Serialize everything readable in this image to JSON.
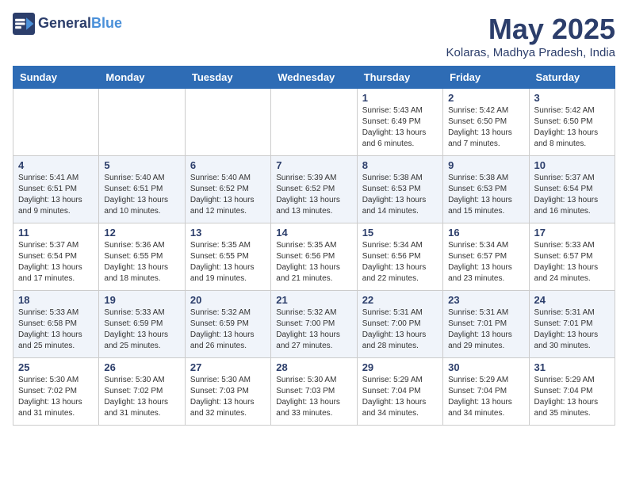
{
  "header": {
    "logo_line1": "General",
    "logo_line2": "Blue",
    "month_title": "May 2025",
    "location": "Kolaras, Madhya Pradesh, India"
  },
  "weekdays": [
    "Sunday",
    "Monday",
    "Tuesday",
    "Wednesday",
    "Thursday",
    "Friday",
    "Saturday"
  ],
  "weeks": [
    [
      {
        "day": "",
        "info": ""
      },
      {
        "day": "",
        "info": ""
      },
      {
        "day": "",
        "info": ""
      },
      {
        "day": "",
        "info": ""
      },
      {
        "day": "1",
        "info": "Sunrise: 5:43 AM\nSunset: 6:49 PM\nDaylight: 13 hours\nand 6 minutes."
      },
      {
        "day": "2",
        "info": "Sunrise: 5:42 AM\nSunset: 6:50 PM\nDaylight: 13 hours\nand 7 minutes."
      },
      {
        "day": "3",
        "info": "Sunrise: 5:42 AM\nSunset: 6:50 PM\nDaylight: 13 hours\nand 8 minutes."
      }
    ],
    [
      {
        "day": "4",
        "info": "Sunrise: 5:41 AM\nSunset: 6:51 PM\nDaylight: 13 hours\nand 9 minutes."
      },
      {
        "day": "5",
        "info": "Sunrise: 5:40 AM\nSunset: 6:51 PM\nDaylight: 13 hours\nand 10 minutes."
      },
      {
        "day": "6",
        "info": "Sunrise: 5:40 AM\nSunset: 6:52 PM\nDaylight: 13 hours\nand 12 minutes."
      },
      {
        "day": "7",
        "info": "Sunrise: 5:39 AM\nSunset: 6:52 PM\nDaylight: 13 hours\nand 13 minutes."
      },
      {
        "day": "8",
        "info": "Sunrise: 5:38 AM\nSunset: 6:53 PM\nDaylight: 13 hours\nand 14 minutes."
      },
      {
        "day": "9",
        "info": "Sunrise: 5:38 AM\nSunset: 6:53 PM\nDaylight: 13 hours\nand 15 minutes."
      },
      {
        "day": "10",
        "info": "Sunrise: 5:37 AM\nSunset: 6:54 PM\nDaylight: 13 hours\nand 16 minutes."
      }
    ],
    [
      {
        "day": "11",
        "info": "Sunrise: 5:37 AM\nSunset: 6:54 PM\nDaylight: 13 hours\nand 17 minutes."
      },
      {
        "day": "12",
        "info": "Sunrise: 5:36 AM\nSunset: 6:55 PM\nDaylight: 13 hours\nand 18 minutes."
      },
      {
        "day": "13",
        "info": "Sunrise: 5:35 AM\nSunset: 6:55 PM\nDaylight: 13 hours\nand 19 minutes."
      },
      {
        "day": "14",
        "info": "Sunrise: 5:35 AM\nSunset: 6:56 PM\nDaylight: 13 hours\nand 21 minutes."
      },
      {
        "day": "15",
        "info": "Sunrise: 5:34 AM\nSunset: 6:56 PM\nDaylight: 13 hours\nand 22 minutes."
      },
      {
        "day": "16",
        "info": "Sunrise: 5:34 AM\nSunset: 6:57 PM\nDaylight: 13 hours\nand 23 minutes."
      },
      {
        "day": "17",
        "info": "Sunrise: 5:33 AM\nSunset: 6:57 PM\nDaylight: 13 hours\nand 24 minutes."
      }
    ],
    [
      {
        "day": "18",
        "info": "Sunrise: 5:33 AM\nSunset: 6:58 PM\nDaylight: 13 hours\nand 25 minutes."
      },
      {
        "day": "19",
        "info": "Sunrise: 5:33 AM\nSunset: 6:59 PM\nDaylight: 13 hours\nand 25 minutes."
      },
      {
        "day": "20",
        "info": "Sunrise: 5:32 AM\nSunset: 6:59 PM\nDaylight: 13 hours\nand 26 minutes."
      },
      {
        "day": "21",
        "info": "Sunrise: 5:32 AM\nSunset: 7:00 PM\nDaylight: 13 hours\nand 27 minutes."
      },
      {
        "day": "22",
        "info": "Sunrise: 5:31 AM\nSunset: 7:00 PM\nDaylight: 13 hours\nand 28 minutes."
      },
      {
        "day": "23",
        "info": "Sunrise: 5:31 AM\nSunset: 7:01 PM\nDaylight: 13 hours\nand 29 minutes."
      },
      {
        "day": "24",
        "info": "Sunrise: 5:31 AM\nSunset: 7:01 PM\nDaylight: 13 hours\nand 30 minutes."
      }
    ],
    [
      {
        "day": "25",
        "info": "Sunrise: 5:30 AM\nSunset: 7:02 PM\nDaylight: 13 hours\nand 31 minutes."
      },
      {
        "day": "26",
        "info": "Sunrise: 5:30 AM\nSunset: 7:02 PM\nDaylight: 13 hours\nand 31 minutes."
      },
      {
        "day": "27",
        "info": "Sunrise: 5:30 AM\nSunset: 7:03 PM\nDaylight: 13 hours\nand 32 minutes."
      },
      {
        "day": "28",
        "info": "Sunrise: 5:30 AM\nSunset: 7:03 PM\nDaylight: 13 hours\nand 33 minutes."
      },
      {
        "day": "29",
        "info": "Sunrise: 5:29 AM\nSunset: 7:04 PM\nDaylight: 13 hours\nand 34 minutes."
      },
      {
        "day": "30",
        "info": "Sunrise: 5:29 AM\nSunset: 7:04 PM\nDaylight: 13 hours\nand 34 minutes."
      },
      {
        "day": "31",
        "info": "Sunrise: 5:29 AM\nSunset: 7:04 PM\nDaylight: 13 hours\nand 35 minutes."
      }
    ]
  ]
}
